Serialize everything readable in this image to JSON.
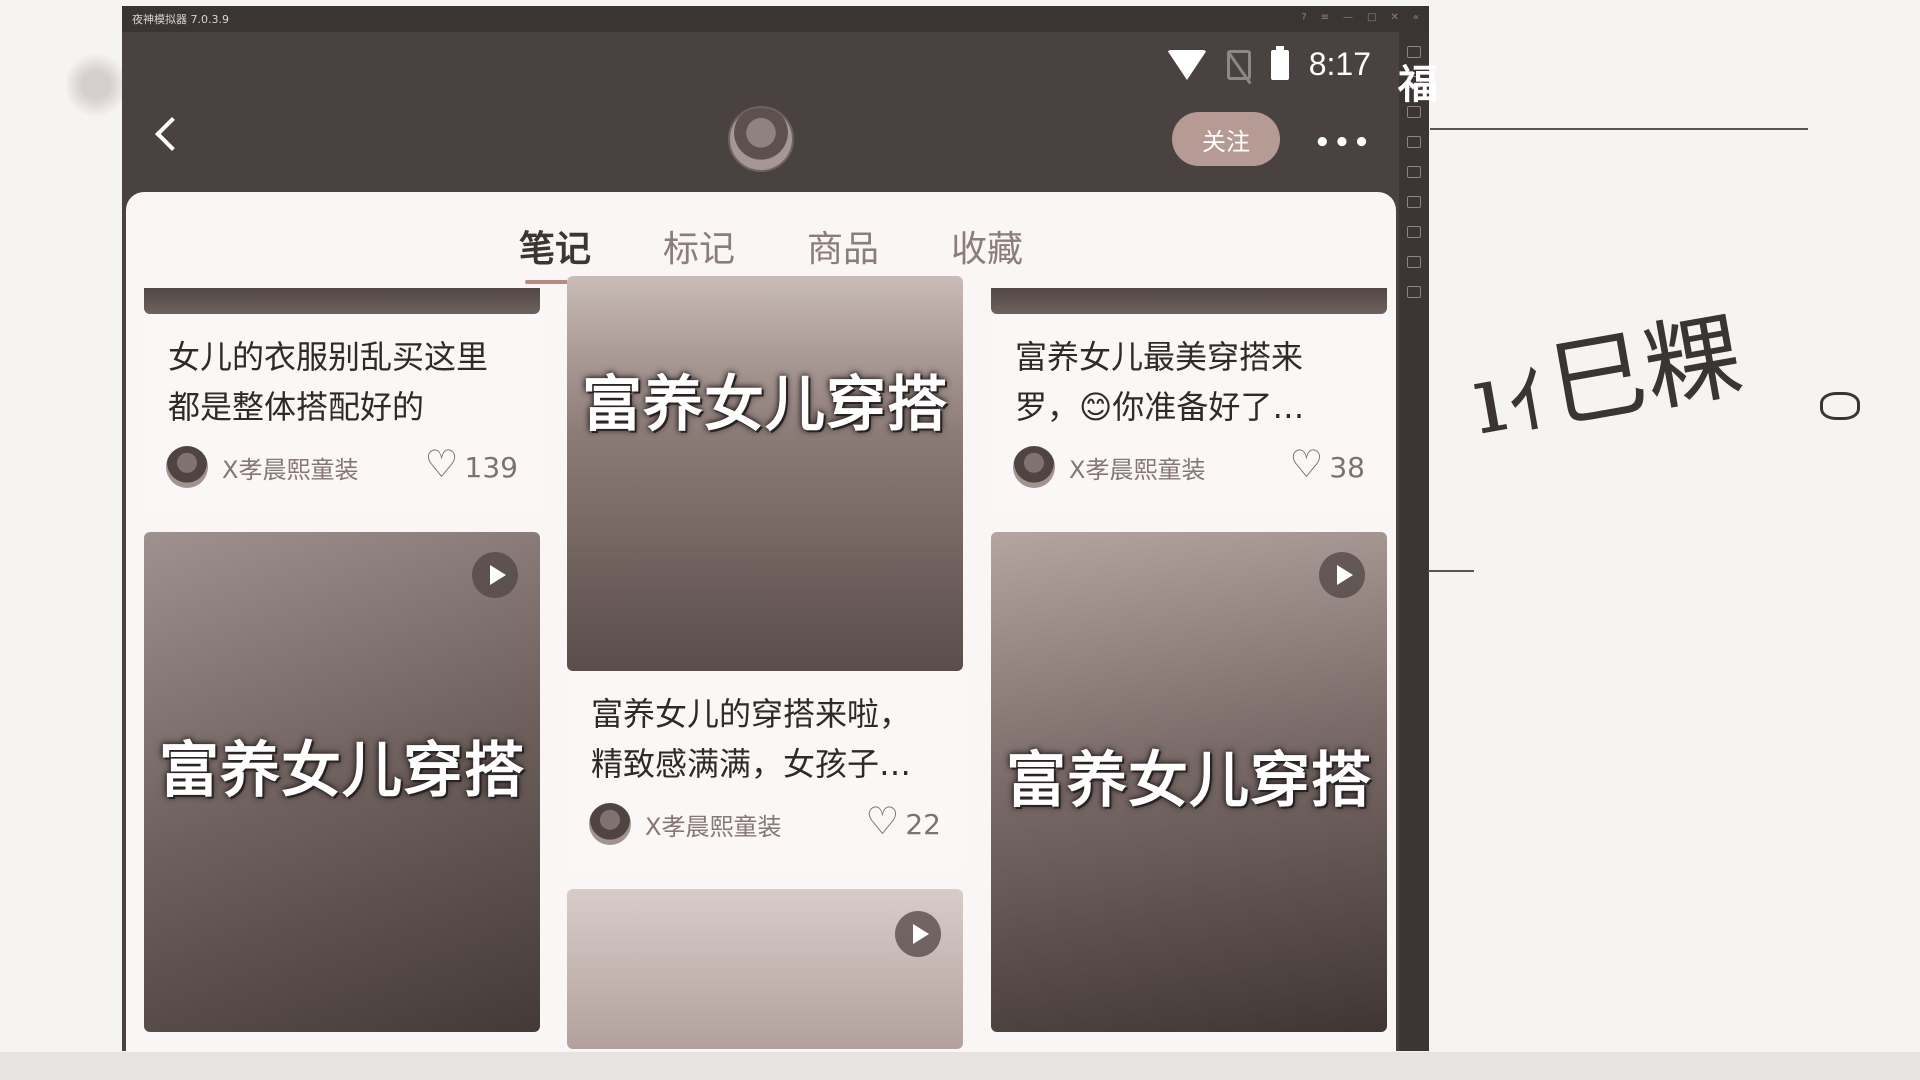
{
  "emulator": {
    "title": "夜神模拟器 7.0.3.9"
  },
  "status_bar": {
    "time": "8:17"
  },
  "header": {
    "follow_label": "关注",
    "more_label": "•••"
  },
  "side_char": "福",
  "tabs": [
    {
      "label": "笔记",
      "active": true
    },
    {
      "label": "标记",
      "active": false
    },
    {
      "label": "商品",
      "active": false
    },
    {
      "label": "收藏",
      "active": false
    }
  ],
  "notes": {
    "col1": [
      {
        "title": "女儿的衣服别乱买这里都是整体搭配好的",
        "author": "X孝晨熙童装",
        "likes": "139"
      },
      {
        "overlay": "富养女儿穿搭",
        "has_video": true
      }
    ],
    "col2": [
      {
        "overlay": "富养女儿穿搭",
        "title": "富养女儿的穿搭来啦，精致感满满，女孩子…",
        "author": "X孝晨熙童装",
        "likes": "22"
      },
      {
        "has_video": true
      }
    ],
    "col3": [
      {
        "title": "富养女儿最美穿搭来罗，😊你准备好了…",
        "author": "X孝晨熙童装",
        "likes": "38"
      },
      {
        "overlay": "富养女儿穿搭",
        "has_video": true
      }
    ]
  },
  "colors": {
    "accent": "#b98a82",
    "follow_bg": "#b69a94",
    "header_bg": "#4a4241"
  }
}
